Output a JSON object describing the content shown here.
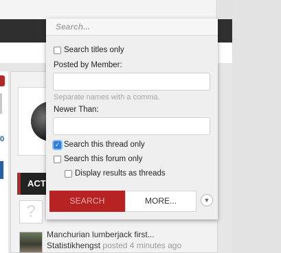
{
  "background": {
    "activity_heading": "ACT",
    "counter": "0",
    "post": {
      "title": "Manchurian lumberjack first...",
      "author": "Statistikhengst",
      "meta": "posted 4 minutes ago"
    }
  },
  "search_popup": {
    "search": {
      "placeholder": "Search..."
    },
    "titles_only": {
      "label": "Search titles only",
      "checked": false
    },
    "posted_by": {
      "label": "Posted by Member:",
      "value": "",
      "hint": "Separate names with a comma."
    },
    "newer_than": {
      "label": "Newer Than:",
      "value": ""
    },
    "this_thread": {
      "label": "Search this thread only",
      "checked": true
    },
    "this_forum": {
      "label": "Search this forum only",
      "checked": false
    },
    "as_threads": {
      "label": "Display results as threads",
      "checked": false
    },
    "buttons": {
      "search": "SEARCH",
      "more": "MORE..."
    }
  },
  "colors": {
    "accent_red": "#b72323",
    "checkbox_blue": "#2f7fd8",
    "nav_dark": "#2f2f2f"
  },
  "icons": {
    "options_toggle": "chevron-down-icon",
    "checkmark": "checkmark-icon",
    "placeholder_avatar": "question-mark-icon"
  }
}
